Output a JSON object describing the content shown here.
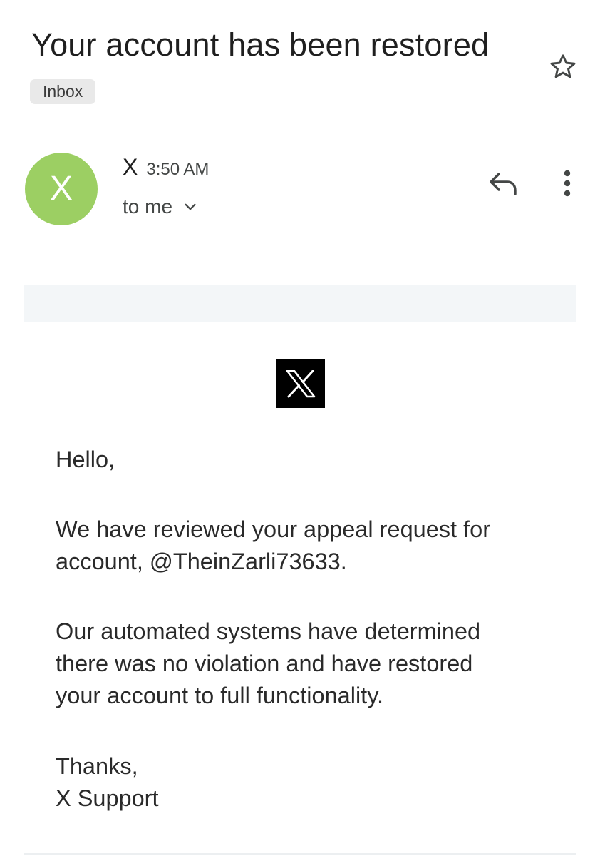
{
  "email": {
    "subject": "Your account has been restored",
    "label": "Inbox",
    "sender": {
      "avatar_letter": "X",
      "avatar_color": "#9ccf63",
      "name": "X",
      "time": "3:50 AM",
      "recipient": "to me"
    },
    "actions": {
      "star_icon": "star-outline-icon",
      "reply_icon": "reply-icon",
      "more_icon": "more-vert-icon",
      "expand_icon": "chevron-down-icon"
    },
    "content": {
      "logo_icon": "x-logo",
      "greeting": "Hello,",
      "paragraph1_line1": "We have reviewed your appeal request for",
      "paragraph1_line2": "account, @TheinZarli73633.",
      "paragraph2_line1": "Our automated systems have determined",
      "paragraph2_line2": "there was no violation and have restored",
      "paragraph2_line3": "your account to full functionality.",
      "signoff": "Thanks,",
      "signature": "X Support"
    }
  }
}
